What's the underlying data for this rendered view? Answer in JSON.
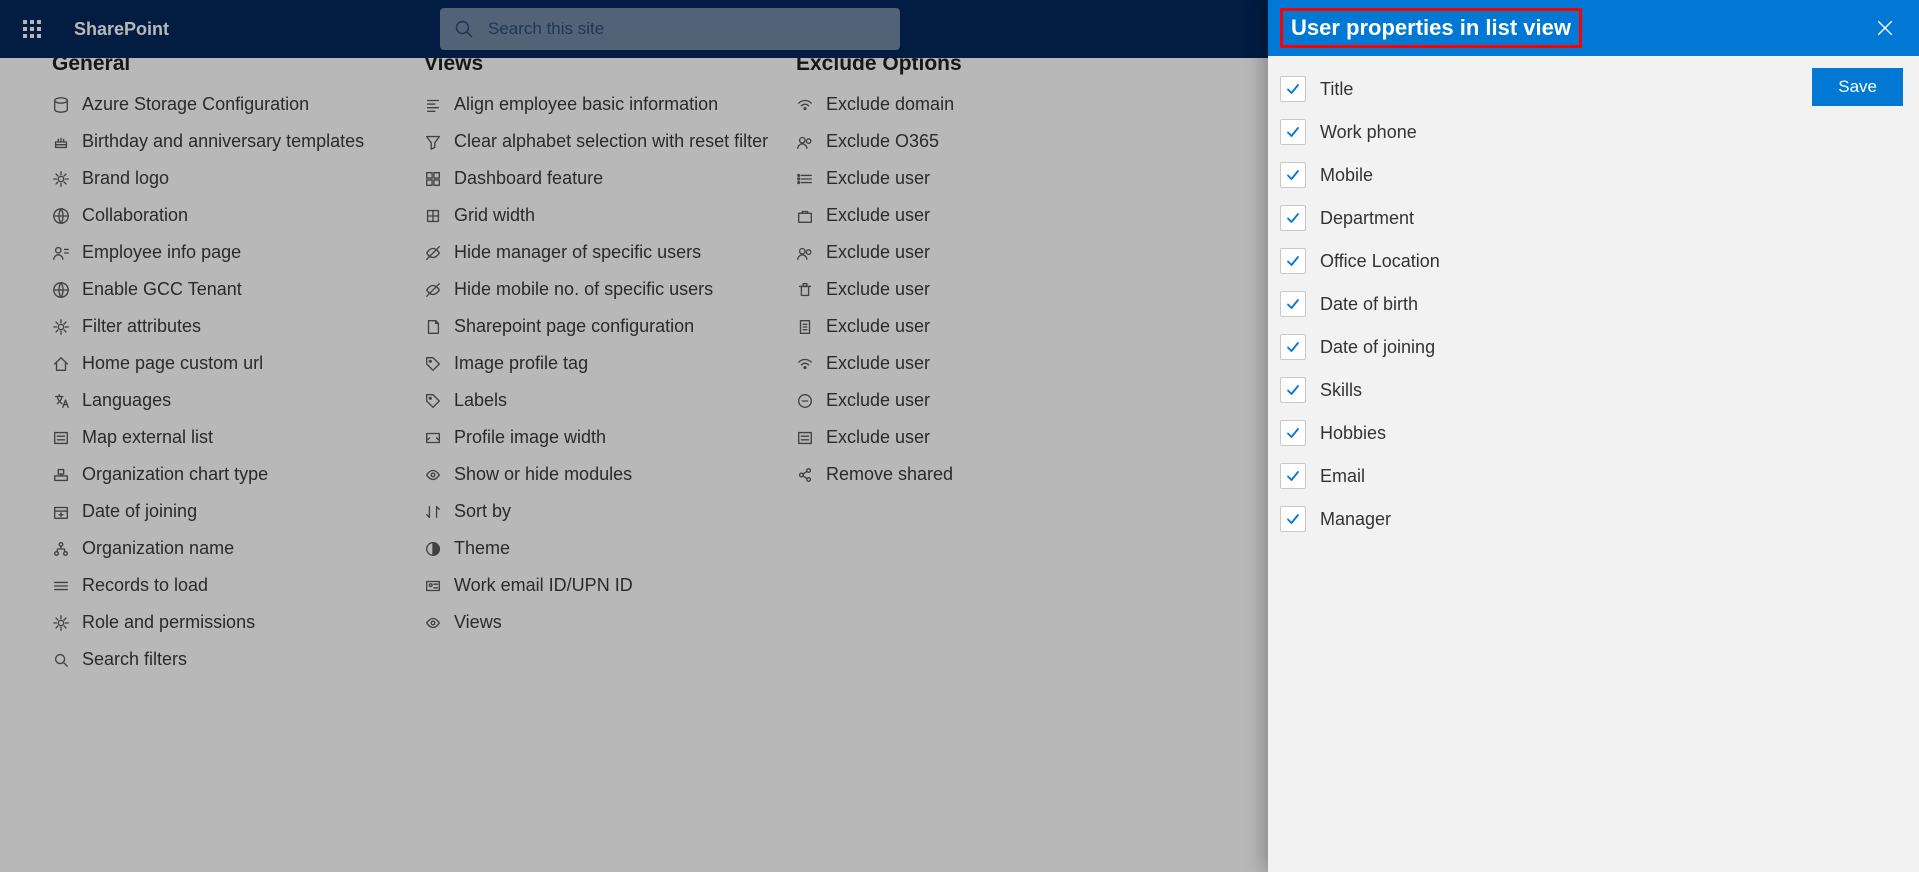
{
  "header": {
    "brand": "SharePoint",
    "search_placeholder": "Search this site"
  },
  "sections": [
    {
      "title": "General",
      "items": [
        {
          "label": "Azure Storage Configuration",
          "icon": "database"
        },
        {
          "label": "Birthday and anniversary templates",
          "icon": "cake"
        },
        {
          "label": "Brand logo",
          "icon": "gear"
        },
        {
          "label": "Collaboration",
          "icon": "globe"
        },
        {
          "label": "Employee info page",
          "icon": "person-info"
        },
        {
          "label": "Enable GCC Tenant",
          "icon": "globe"
        },
        {
          "label": "Filter attributes",
          "icon": "gear"
        },
        {
          "label": "Home page custom url",
          "icon": "home"
        },
        {
          "label": "Languages",
          "icon": "language"
        },
        {
          "label": "Map external list",
          "icon": "list-map"
        },
        {
          "label": "Organization chart type",
          "icon": "org"
        },
        {
          "label": "Date of joining",
          "icon": "calendar-plus"
        },
        {
          "label": "Organization name",
          "icon": "org-tree"
        },
        {
          "label": "Records to load",
          "icon": "rows"
        },
        {
          "label": "Role and permissions",
          "icon": "gear"
        },
        {
          "label": "Search filters",
          "icon": "search"
        }
      ]
    },
    {
      "title": "Views",
      "items": [
        {
          "label": "Align employee basic information",
          "icon": "align"
        },
        {
          "label": "Clear alphabet selection with reset filter",
          "icon": "filter"
        },
        {
          "label": "Dashboard feature",
          "icon": "dashboard"
        },
        {
          "label": "Grid width",
          "icon": "grid"
        },
        {
          "label": "Hide manager of specific users",
          "icon": "hide"
        },
        {
          "label": "Hide mobile no. of specific users",
          "icon": "hide"
        },
        {
          "label": "Sharepoint page configuration",
          "icon": "page"
        },
        {
          "label": "Image profile tag",
          "icon": "tag"
        },
        {
          "label": "Labels",
          "icon": "tag"
        },
        {
          "label": "Profile image width",
          "icon": "image-width"
        },
        {
          "label": "Show or hide modules",
          "icon": "eye"
        },
        {
          "label": "Sort by",
          "icon": "sort"
        },
        {
          "label": "Theme",
          "icon": "theme"
        },
        {
          "label": "Work email ID/UPN ID",
          "icon": "id-card"
        },
        {
          "label": "Views",
          "icon": "eye"
        }
      ]
    },
    {
      "title": "Exclude Options",
      "items": [
        {
          "label": "Exclude domain",
          "icon": "wifi"
        },
        {
          "label": "Exclude O365",
          "icon": "people"
        },
        {
          "label": "Exclude user",
          "icon": "list"
        },
        {
          "label": "Exclude user",
          "icon": "briefcase"
        },
        {
          "label": "Exclude user",
          "icon": "people"
        },
        {
          "label": "Exclude user",
          "icon": "trash"
        },
        {
          "label": "Exclude user",
          "icon": "office"
        },
        {
          "label": "Exclude user",
          "icon": "wifi"
        },
        {
          "label": "Exclude user",
          "icon": "remove"
        },
        {
          "label": "Exclude user",
          "icon": "list2"
        },
        {
          "label": "Remove shared",
          "icon": "share"
        }
      ]
    }
  ],
  "panel": {
    "title": "User properties in list view",
    "save_label": "Save",
    "properties": [
      {
        "label": "Title",
        "checked": true
      },
      {
        "label": "Work phone",
        "checked": true
      },
      {
        "label": "Mobile",
        "checked": true
      },
      {
        "label": "Department",
        "checked": true
      },
      {
        "label": "Office Location",
        "checked": true
      },
      {
        "label": "Date of birth",
        "checked": true
      },
      {
        "label": "Date of joining",
        "checked": true
      },
      {
        "label": "Skills",
        "checked": true
      },
      {
        "label": "Hobbies",
        "checked": true
      },
      {
        "label": "Email",
        "checked": true
      },
      {
        "label": "Manager",
        "checked": true
      }
    ]
  }
}
